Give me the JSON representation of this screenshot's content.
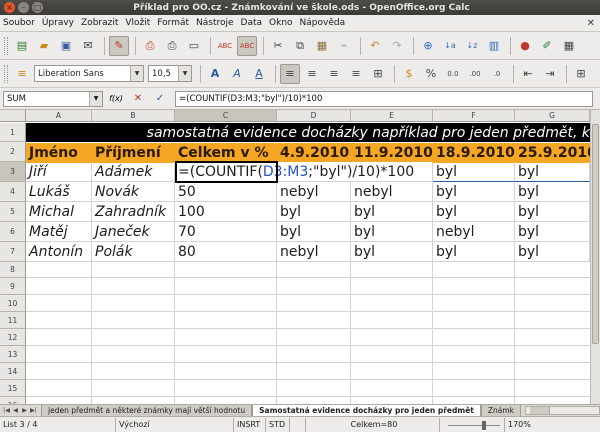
{
  "window": {
    "title": "Příklad pro OO.cz - Známkování ve škole.ods - OpenOffice.org Calc"
  },
  "menu": [
    "Soubor",
    "Úpravy",
    "Zobrazit",
    "Vložit",
    "Formát",
    "Nástroje",
    "Data",
    "Okno",
    "Nápověda"
  ],
  "formatting": {
    "font_name": "Liberation Sans",
    "font_size": "10,5"
  },
  "formula_bar": {
    "name_box": "SUM",
    "fx_label": "f(x)",
    "formula": "=(COUNTIF(D3:M3;\"byl\")/10)*100"
  },
  "columns": [
    "A",
    "B",
    "C",
    "D",
    "E",
    "F",
    "G"
  ],
  "rows": [
    "1",
    "2",
    "3",
    "4",
    "5",
    "6",
    "7",
    "8",
    "9",
    "10",
    "11",
    "12",
    "13",
    "14",
    "15",
    "16"
  ],
  "sheet": {
    "banner": "samostatná evidence docházky například pro jeden předmět, k",
    "headers": [
      "Jméno",
      "Příjmení",
      "Celkem v %",
      "4.9.2010",
      "11.9.2010",
      "18.9.2010",
      "25.9.2010"
    ],
    "edit": {
      "prefix": "=(COUNTIF(",
      "ref": "D3:M3",
      "suffix": ";\"byl\")/10)*100"
    },
    "data_rows": [
      {
        "name": "Jiří",
        "surname": "Adámek",
        "total": "",
        "d": "",
        "e": "",
        "f": "byl",
        "g": "byl"
      },
      {
        "name": "Lukáš",
        "surname": "Novák",
        "total": "50",
        "d": "nebyl",
        "e": "nebyl",
        "f": "byl",
        "g": "byl"
      },
      {
        "name": "Michal",
        "surname": "Zahradník",
        "total": "100",
        "d": "byl",
        "e": "byl",
        "f": "byl",
        "g": "byl"
      },
      {
        "name": "Matěj",
        "surname": "Janeček",
        "total": "70",
        "d": "byl",
        "e": "byl",
        "f": "nebyl",
        "g": "byl"
      },
      {
        "name": "Antonín",
        "surname": "Polák",
        "total": "80",
        "d": "nebyl",
        "e": "byl",
        "f": "byl",
        "g": "byl"
      }
    ]
  },
  "tabs": [
    "jeden předmět a některé známky mají větší hodnotu",
    "Samostatná evidence docházky pro jeden předmět",
    "Známk"
  ],
  "status": {
    "sheet": "List 3 / 4",
    "style": "Výchozí",
    "insert": "INSRT",
    "selection": "STD",
    "sum": "Celkem=80",
    "zoom": "170%"
  }
}
